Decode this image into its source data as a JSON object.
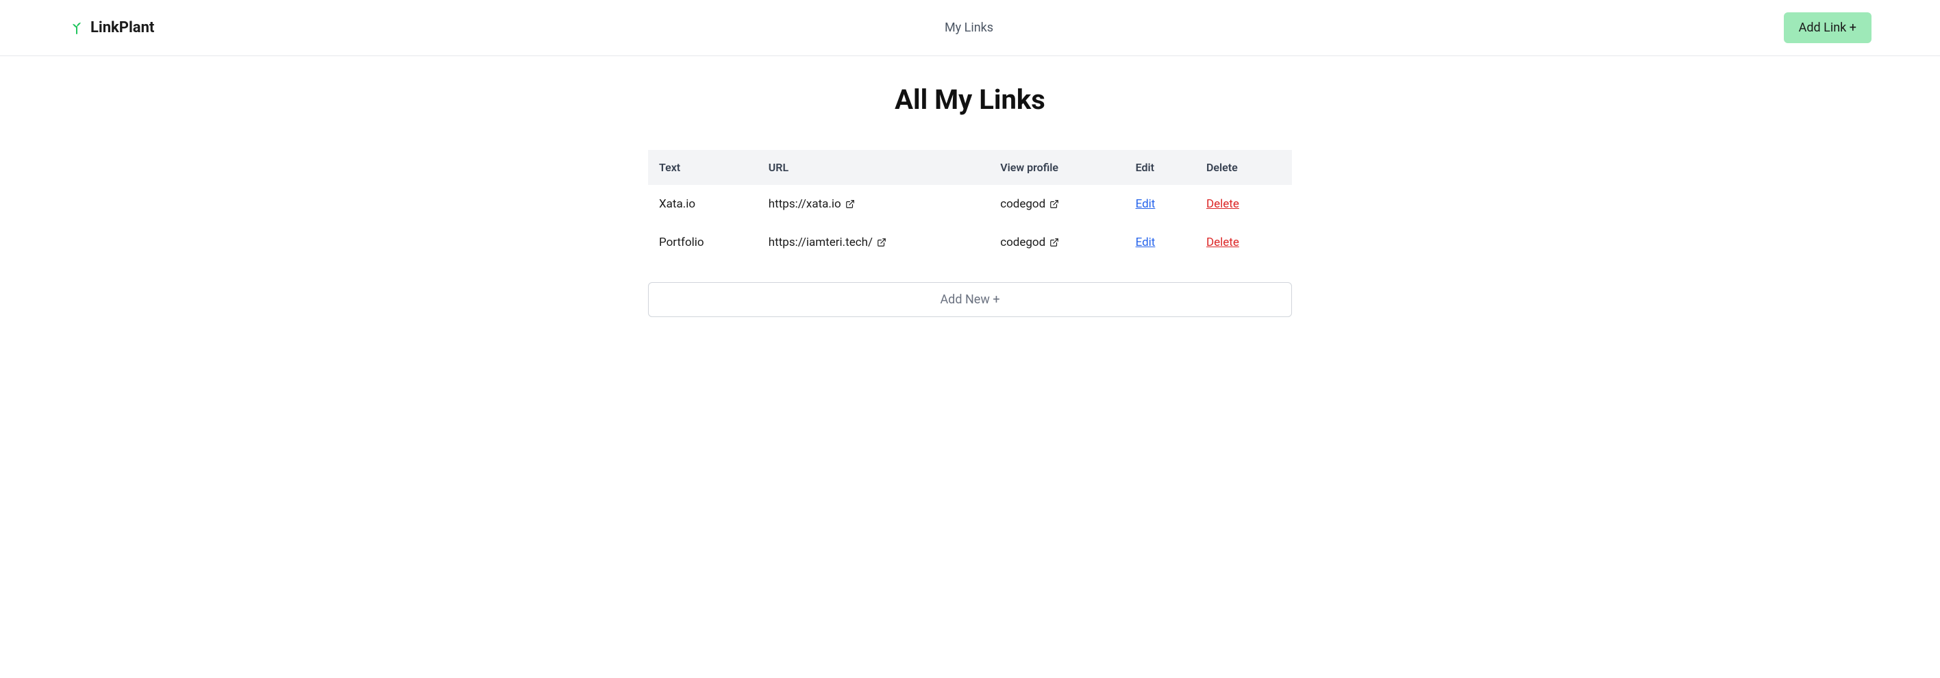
{
  "header": {
    "brand": "LinkPlant",
    "nav_link": "My Links",
    "add_link_label": "Add Link +"
  },
  "page": {
    "title": "All My Links",
    "add_new_label": "Add New +"
  },
  "table": {
    "headers": {
      "text": "Text",
      "url": "URL",
      "profile": "View profile",
      "edit": "Edit",
      "delete": "Delete"
    },
    "rows": [
      {
        "text": "Xata.io",
        "url": "https://xata.io",
        "profile": "codegod",
        "edit": "Edit",
        "delete": "Delete"
      },
      {
        "text": "Portfolio",
        "url": "https://iamteri.tech/",
        "profile": "codegod",
        "edit": "Edit",
        "delete": "Delete"
      }
    ]
  }
}
